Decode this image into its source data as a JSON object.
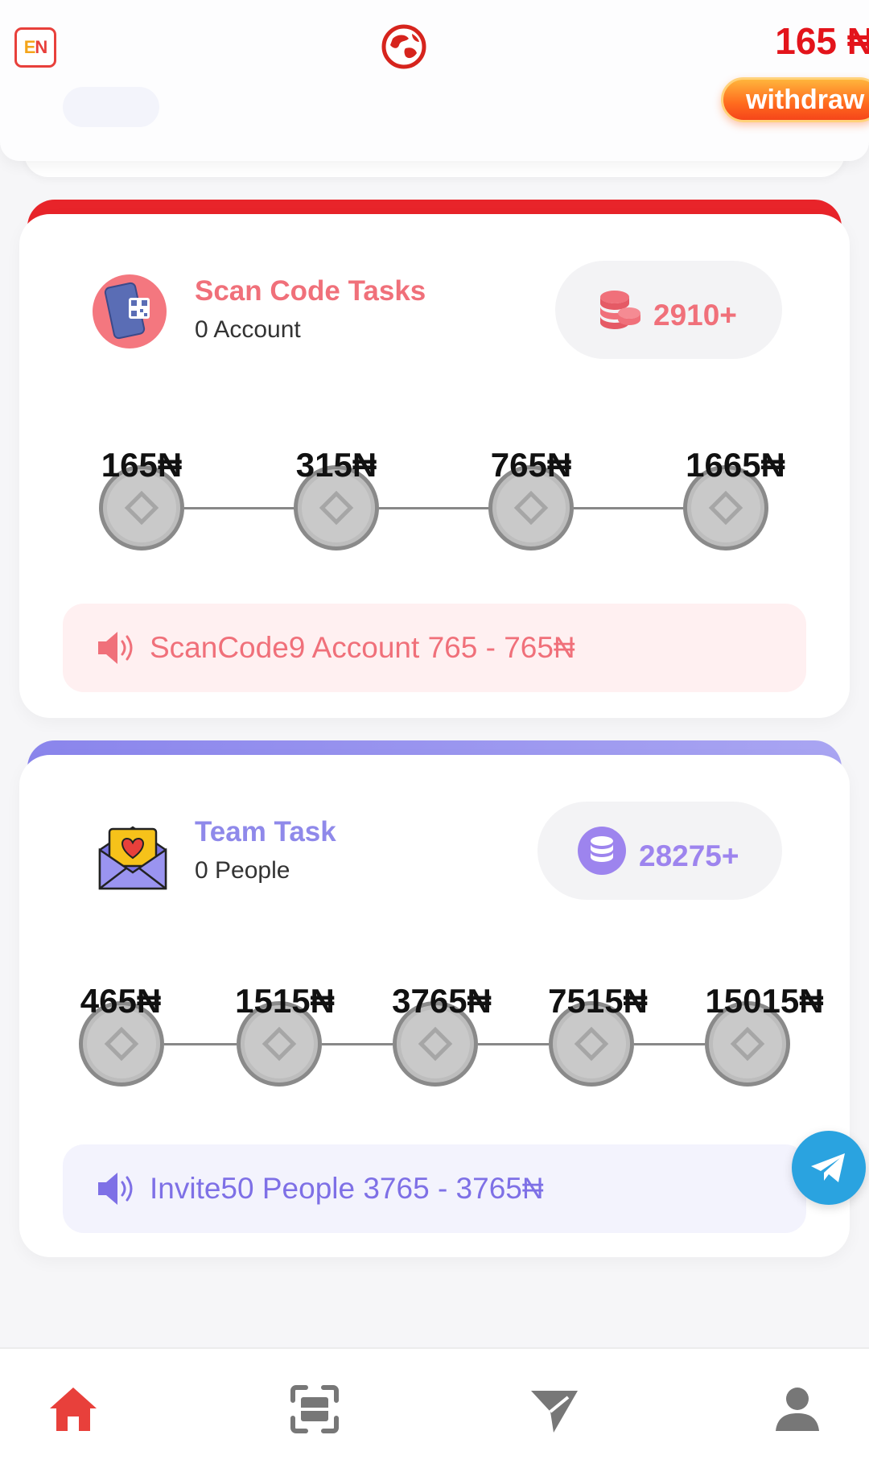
{
  "header": {
    "language_badge_e": "E",
    "language_badge_n": "N",
    "balance": "165 ₦",
    "withdraw_label": "withdraw"
  },
  "scan_task": {
    "title": "Scan Code Tasks",
    "subtitle": "0 Account",
    "reward": "2910+",
    "milestones": [
      "165₦",
      "315₦",
      "765₦",
      "1665₦"
    ],
    "notice": "ScanCode9 Account 765 - 765₦",
    "accent_color": "#f0707a",
    "bar_color": "#e8242a"
  },
  "team_task": {
    "title": "Team Task",
    "subtitle": "0 People",
    "reward": "28275+",
    "milestones": [
      "465₦",
      "1515₦",
      "3765₦",
      "7515₦",
      "15015₦"
    ],
    "notice": "Invite50 People 3765 - 3765₦",
    "accent_color": "#8f89ea",
    "bar_color": "#9a95ee"
  },
  "icons": {
    "header": [
      "language-icon",
      "globe-icon"
    ],
    "floating": "telegram-icon",
    "bottom_nav": [
      "home-icon",
      "scan-icon",
      "send-icon",
      "profile-icon"
    ]
  },
  "colors": {
    "brand_red": "#e3141b",
    "withdraw_orange": "#ff6a1e",
    "telegram_blue": "#2aa3e0",
    "nav_active": "#e8403b",
    "nav_inactive": "#777777"
  }
}
